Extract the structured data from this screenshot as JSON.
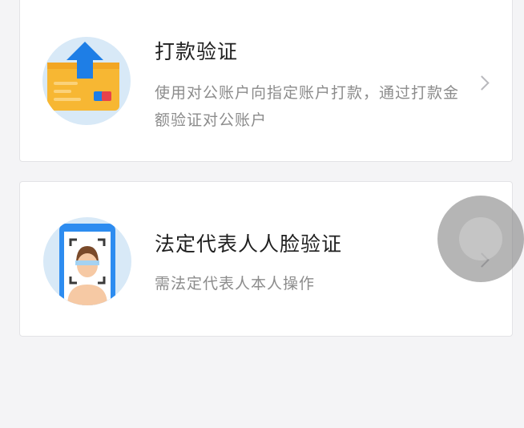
{
  "options": [
    {
      "title": "打款验证",
      "description": "使用对公账户向指定账户打款，通过打款金额验证对公账户",
      "icon": "bank-transfer-icon"
    },
    {
      "title": "法定代表人人脸验证",
      "description": "需法定代表人本人操作",
      "icon": "face-recognition-icon"
    }
  ],
  "colors": {
    "background": "#f4f4f6",
    "icon_circle": "#d8e9f7",
    "card_orange": "#f7b733",
    "arrow_blue": "#1e7ee6",
    "title": "#1f1f1f",
    "description": "#8c8c8c"
  }
}
